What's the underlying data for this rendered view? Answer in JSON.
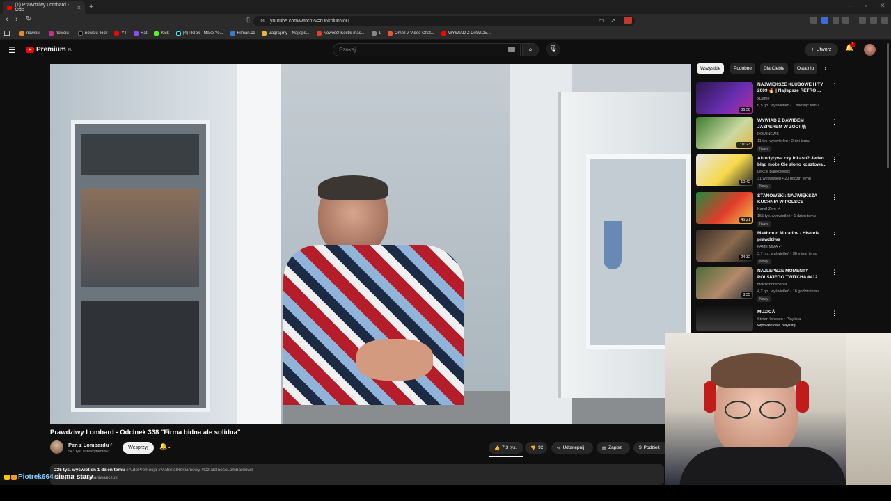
{
  "browser": {
    "tab_title": "(1) Prawdziwy Lombard - Odc",
    "new_tab": "+",
    "url": "youtube.com/watch?v=rD6koiunNoU",
    "bookmarks": [
      "nowciu_",
      "nowciu_kick",
      "YT",
      "Rat",
      "Kick",
      "(4)TikTok - Make Yo...",
      "Filman.cc",
      "Zagraj.my – Najleps...",
      "Nowość! Kostki mas...",
      "1",
      "OmeTV Video Chat...",
      "WYWIAD Z DAWIDE..."
    ]
  },
  "youtube": {
    "logo_text": "Premium",
    "logo_region": "PL",
    "search_placeholder": "Szukaj",
    "create_label": "Utwórz",
    "notification_count": "1"
  },
  "video": {
    "title": "Prawdziwy Lombard - Odcinek 338 \"Firma bidna ale solidna\"",
    "channel": "Pan z Lombardu",
    "subscribers": "543 tys. subskrybentów",
    "support_label": "Wesprzyj",
    "likes": "7,3 tys.",
    "dislikes": "92",
    "share_label": "Udostępnij",
    "save_label": "Zapisz",
    "thanks_label": "Podzięk",
    "views_date": "225 tys. wyświetleń  1 dzień temu",
    "hashtags": "#AutoPromocja #MateriałReklamowy #DziałalnośćLombardowa",
    "desc_line2": "Instagram: / @damianiwanczuk"
  },
  "chat": {
    "user": "Piotrek664",
    "message": "siema stary"
  },
  "sidebar": {
    "chips": [
      "Wszystkie",
      "Podobne",
      "Dla Ciebie",
      "Ostatnio"
    ],
    "items": [
      {
        "title": "NAJWIĘKSZE KLUBOWE HITY 2009 🔥 | Najlepsze RETRO ...",
        "channel": "xDame",
        "meta": "6,5 tys. wyświetleń • 1 miesiąc temu",
        "duration": "36:38",
        "badge": ""
      },
      {
        "title": "WYWIAD Z DAWIDEM JASPEREM W ZOO! 🐘",
        "channel": "DOMINEWS",
        "meta": "11 tys. wyświetleń • 2 dni temu",
        "duration": "1:11:23",
        "badge": "Nowy"
      },
      {
        "title": "Akredytywa czy inkaso? Jeden błąd może Cię słono kosztowa...",
        "channel": "Lekcje Bankowości",
        "meta": "31 wyświetleń • 20 godzin temu",
        "duration": "10:42",
        "badge": "Nowy"
      },
      {
        "title": "STANOWSKI: NAJWIĘKSZA KUCHNIA W POLSCE",
        "channel": "Kanał Zero ✔",
        "meta": "155 tys. wyświetleń • 1 dzień temu",
        "duration": "45:21",
        "badge": "Nowy"
      },
      {
        "title": "Makhmud Muradov - Historia prawdziwa",
        "channel": "FAME MMA ✔",
        "meta": "3,7 tys. wyświetleń • 38 minut temu",
        "duration": "24:32",
        "badge": "Nowy"
      },
      {
        "title": "NAJLEPSZE MOMENTY POLSKIEGO TWITCHA #412",
        "channel": "twitchshotsmania",
        "meta": "4,2 tys. wyświetleń • 16 godzin temu",
        "duration": "8:35",
        "badge": "Nowy"
      },
      {
        "title": "MUZICĂ",
        "channel": "Stefan Ionescu • Playlista",
        "meta": "Wyświetl całą playlistę",
        "duration": "",
        "badge": ""
      }
    ]
  },
  "colors": {
    "accent": "#ff0000",
    "bg": "#0f0f0f",
    "chip": "#272727"
  }
}
